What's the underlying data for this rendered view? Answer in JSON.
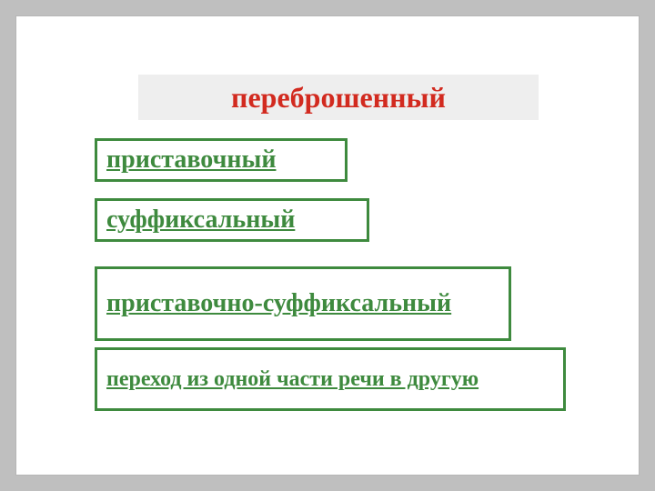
{
  "title": "переброшенный",
  "options": {
    "o1": "приставочный",
    "o2": "суффиксальный",
    "o3": "приставочно-суффиксальный",
    "o4": "переход из одной части речи в другую"
  }
}
